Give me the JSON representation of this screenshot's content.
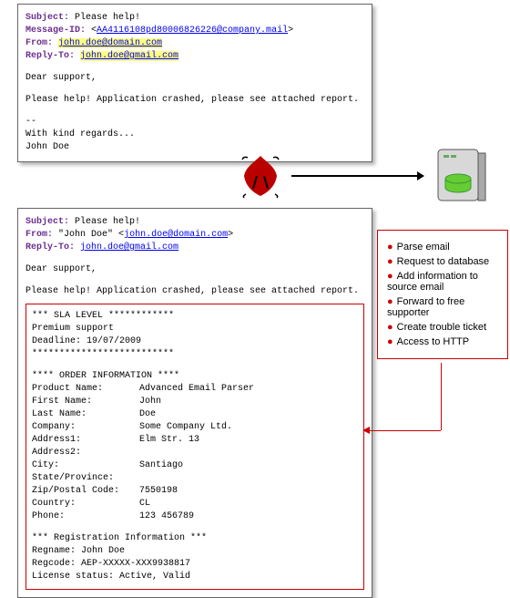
{
  "email_in": {
    "subject_label": "Subject:",
    "subject": "Please help!",
    "msgid_label": "Message-ID:",
    "msgid": "AA4116108pd80006826226@company.mail",
    "from_label": "From:",
    "from": "john.doe@domain.com",
    "reply_label": "Reply-To:",
    "reply": "john.doe@gmail.com",
    "greeting": "Dear support,",
    "body": "Please help! Application crashed, please see attached report.",
    "sep": "--",
    "sig1": "With kind regards...",
    "sig2": "John Doe"
  },
  "email_out": {
    "subject_label": "Subject:",
    "subject": "Please help!",
    "from_label": "From:",
    "from_name": "\"John Doe\"",
    "from_addr": "john.doe@domain.com",
    "reply_label": "Reply-To:",
    "reply": "john.doe@gmail.com",
    "greeting": "Dear support,",
    "body": "Please help! Application crashed, please see attached report.",
    "sla_header": "*** SLA LEVEL ************",
    "sla_line1": "Premium support",
    "sla_line2": "Deadline: 19/07/2009",
    "sla_footer": "**************************",
    "order_header": "**** ORDER INFORMATION ****",
    "product_lbl": "Product Name:",
    "product": "Advanced Email Parser",
    "first_lbl": "First Name:",
    "first": "John",
    "last_lbl": "Last Name:",
    "last": "Doe",
    "company_lbl": "Company:",
    "company": "Some Company Ltd.",
    "addr1_lbl": "Address1:",
    "addr1": "Elm Str. 13",
    "addr2_lbl": "Address2:",
    "addr2": "",
    "city_lbl": "City:",
    "city": "Santiago",
    "state_lbl": "State/Province:",
    "state": "",
    "zip_lbl": "Zip/Postal Code:",
    "zip": "7550198",
    "country_lbl": "Country:",
    "country": "CL",
    "phone_lbl": "Phone:",
    "phone": "123 456789",
    "reg_header": "*** Registration Information ***",
    "regname": "Regname: John Doe",
    "regcode": "Regcode: AEP-XXXXX-XXX9938817",
    "license": "License status: Active, Valid"
  },
  "steps": {
    "s1": "Parse email",
    "s2": "Request to database",
    "s3": "Add information to source email",
    "s4": "Forward to free supporter",
    "s5": "Create trouble ticket",
    "s6": "Access to HTTP"
  },
  "icons": {
    "parser": "parser-logo",
    "server": "database-server"
  }
}
